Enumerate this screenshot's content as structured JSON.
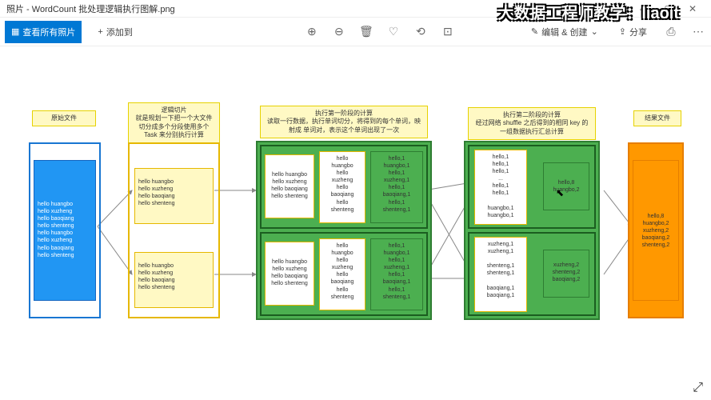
{
  "title": "照片 - WordCount 批处理逻辑执行图解.png",
  "overlay": "大数据工程师教学：liaoit",
  "toolbar": {
    "viewAll": "查看所有照片",
    "addTo": "添加到",
    "edit": "编辑 & 创建",
    "share": "分享"
  },
  "notes": {
    "n1": "原始文件",
    "n2": "逻辑切片\n就是规划一下把一个大文件切分成多个分段使用多个 Task 来分别执行计算",
    "n3": "执行第一阶段的计算\n读取一行数据，执行单词切分，将得到的每个单词，映射成 单词对，表示这个单词出现了一次",
    "n4": "执行第二阶段的计算\n经过网络 shuffle 之后得到的相同 key 的一组数据执行汇总计算",
    "n5": "结果文件"
  },
  "input": "hello huangbo\nhello xuzheng\nhello baoqiang\nhello shenteng\nhello huangbo\nhello xuzheng\nhello baoqiang\nhello shenteng",
  "split1": "hello huangbo\nhello xuzheng\nhello baoqiang\nhello shenteng",
  "split2": "hello huangbo\nhello xuzheng\nhello baoqiang\nhello shenteng",
  "map_in1": "hello huangbo\nhello xuzheng\nhello baoqiang\nhello shenteng",
  "map_mid1": "hello\nhuangbo\nhello\nxuzheng\nhello\nbaoqiang\nhello\nshenteng",
  "map_out1": "hello,1\nhuangbo,1\nhello,1\nxuzheng,1\nhello,1\nbaoqiang,1\nhello,1\nshenteng,1",
  "map_in2": "hello huangbo\nhello xuzheng\nhello baoqiang\nhello shenteng",
  "map_mid2": "hello\nhuangbo\nhello\nxuzheng\nhello\nbaoqiang\nhello\nshenteng",
  "map_out2": "hello,1\nhuangbo,1\nhello,1\nxuzheng,1\nhello,1\nbaoqiang,1\nhello,1\nshenteng,1",
  "red_in1": "hello,1\nhello,1\nhello,1\n...\nhello,1\nhello,1\n\nhuangbo,1\nhuangbo,1",
  "red_out1": "hello,8\nhuangbo,2",
  "red_in2": "xuzheng,1\nxuzheng,1\n\nshenteng,1\nshenteng,1\n\nbaoqiang,1\nbaoqiang,1",
  "red_out2": "xuzheng,2\nshenteng,2\nbaoqiang,2",
  "result": "hello,8\nhuangbo,2\nxuzheng,2\nbaoqiang,2\nshenteng,2"
}
